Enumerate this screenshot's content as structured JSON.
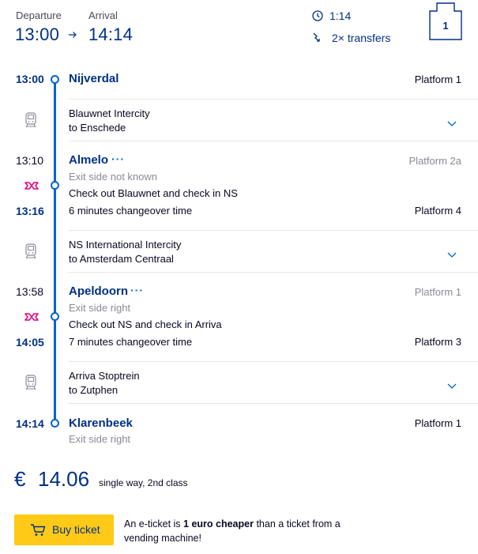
{
  "header": {
    "departure_label": "Departure",
    "arrival_label": "Arrival",
    "departure_time": "13:00",
    "arrival_time": "14:14",
    "duration": "1:14",
    "transfers": "2× transfers",
    "ticket_count": "1"
  },
  "stops": [
    {
      "time": "13:00",
      "name": "Nijverdal",
      "platform": "Platform 1"
    },
    {
      "time_arrival": "13:10",
      "name": "Almelo",
      "more": "···",
      "arrival_platform": "Platform 2a",
      "exit_side": "Exit side not known",
      "transfer_note": "Check out Blauwnet and check in NS",
      "time_departure": "13:16",
      "changeover": "6 minutes changeover time",
      "departure_platform": "Platform 4"
    },
    {
      "time_arrival": "13:58",
      "name": "Apeldoorn",
      "more": "···",
      "arrival_platform": "Platform 1",
      "exit_side": "Exit side right",
      "transfer_note": "Check out NS and check in Arriva",
      "time_departure": "14:05",
      "changeover": "7 minutes changeover time",
      "departure_platform": "Platform 3"
    },
    {
      "time": "14:14",
      "name": "Klarenbeek",
      "platform": "Platform 1",
      "exit_side": "Exit side right"
    }
  ],
  "legs": [
    {
      "service": "Blauwnet Intercity",
      "direction": "to Enschede"
    },
    {
      "service": "NS International Intercity",
      "direction": "to Amsterdam Centraal"
    },
    {
      "service": "Arriva Stoptrein",
      "direction": "to Zutphen"
    }
  ],
  "price": {
    "currency": "€",
    "amount": "14.06",
    "description": "single way, 2nd class"
  },
  "buy": {
    "label": "Buy ticket",
    "note_prefix": "An e-ticket is ",
    "note_bold": "1 euro cheaper",
    "note_suffix": " than a ticket from a vending machine!"
  },
  "colors": {
    "brand_blue": "#003082",
    "route_blue": "#0063d3",
    "button_yellow": "#ffc917",
    "transfer_pink": "#e5007d"
  }
}
